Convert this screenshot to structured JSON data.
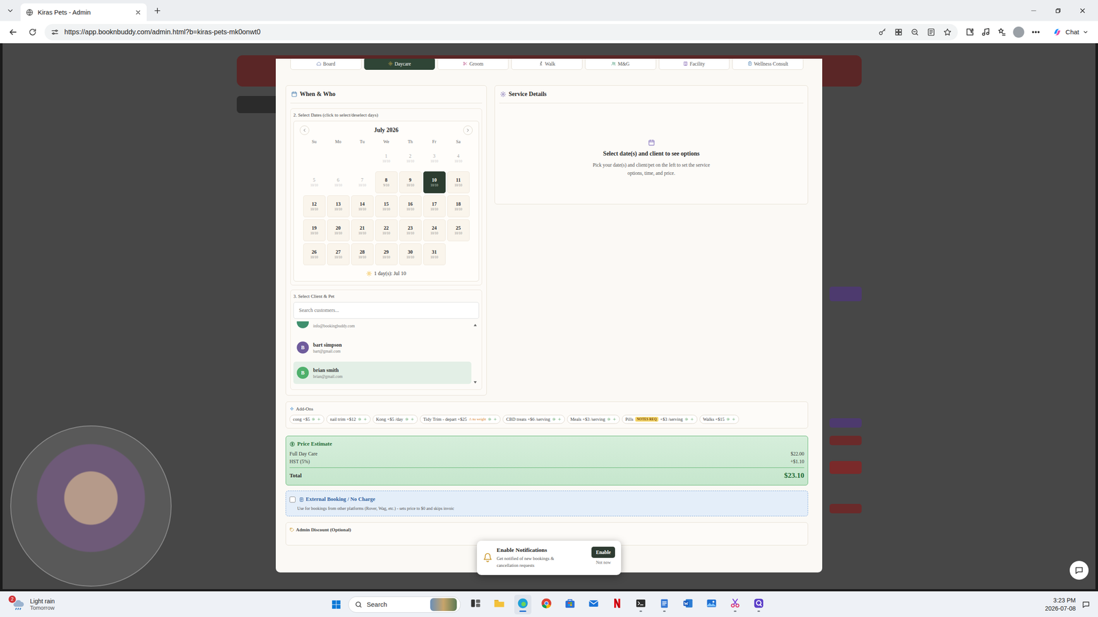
{
  "browser": {
    "tab_title": "Kiras Pets - Admin",
    "url": "https://app.booknbuddy.com/admin.html?b=kiras-pets-mk0onwt0",
    "chat": "Chat"
  },
  "service_tabs": [
    {
      "label": "Board",
      "selected": false
    },
    {
      "label": "Daycare",
      "selected": true
    },
    {
      "label": "Groom",
      "selected": false
    },
    {
      "label": "Walk",
      "selected": false
    },
    {
      "label": "M&G",
      "selected": false
    },
    {
      "label": "Facility",
      "selected": false
    },
    {
      "label": "Wellness Consult",
      "selected": false
    }
  ],
  "when_who": {
    "title": "When & Who",
    "dates_label": "2. Select Dates (click to select/deselect days)",
    "month": "July 2026",
    "weekdays": [
      "Su",
      "Mo",
      "Tu",
      "We",
      "Th",
      "Fr",
      "Sa"
    ],
    "leading_blanks": 3,
    "days": [
      {
        "day": "1",
        "sub": "10/10",
        "disabled": true,
        "selected": false
      },
      {
        "day": "2",
        "sub": "10/10",
        "disabled": true,
        "selected": false
      },
      {
        "day": "3",
        "sub": "10/10",
        "disabled": true,
        "selected": false
      },
      {
        "day": "4",
        "sub": "10/10",
        "disabled": true,
        "selected": false
      },
      {
        "day": "5",
        "sub": "10/10",
        "disabled": true,
        "selected": false
      },
      {
        "day": "6",
        "sub": "10/10",
        "disabled": true,
        "selected": false
      },
      {
        "day": "7",
        "sub": "10/10",
        "disabled": true,
        "selected": false
      },
      {
        "day": "8",
        "sub": "9/10",
        "disabled": false,
        "selected": false
      },
      {
        "day": "9",
        "sub": "10/10",
        "disabled": false,
        "selected": false
      },
      {
        "day": "10",
        "sub": "10/10",
        "disabled": false,
        "selected": true
      },
      {
        "day": "11",
        "sub": "10/10",
        "disabled": false,
        "selected": false
      },
      {
        "day": "12",
        "sub": "10/10",
        "disabled": false,
        "selected": false
      },
      {
        "day": "13",
        "sub": "10/10",
        "disabled": false,
        "selected": false
      },
      {
        "day": "14",
        "sub": "10/10",
        "disabled": false,
        "selected": false
      },
      {
        "day": "15",
        "sub": "10/10",
        "disabled": false,
        "selected": false
      },
      {
        "day": "16",
        "sub": "10/10",
        "disabled": false,
        "selected": false
      },
      {
        "day": "17",
        "sub": "10/10",
        "disabled": false,
        "selected": false
      },
      {
        "day": "18",
        "sub": "10/10",
        "disabled": false,
        "selected": false
      },
      {
        "day": "19",
        "sub": "10/10",
        "disabled": false,
        "selected": false
      },
      {
        "day": "20",
        "sub": "10/10",
        "disabled": false,
        "selected": false
      },
      {
        "day": "21",
        "sub": "10/10",
        "disabled": false,
        "selected": false
      },
      {
        "day": "22",
        "sub": "10/10",
        "disabled": false,
        "selected": false
      },
      {
        "day": "23",
        "sub": "10/10",
        "disabled": false,
        "selected": false
      },
      {
        "day": "24",
        "sub": "10/10",
        "disabled": false,
        "selected": false
      },
      {
        "day": "25",
        "sub": "10/10",
        "disabled": false,
        "selected": false
      },
      {
        "day": "26",
        "sub": "10/10",
        "disabled": false,
        "selected": false
      },
      {
        "day": "27",
        "sub": "10/10",
        "disabled": false,
        "selected": false
      },
      {
        "day": "28",
        "sub": "10/10",
        "disabled": false,
        "selected": false
      },
      {
        "day": "29",
        "sub": "10/10",
        "disabled": false,
        "selected": false
      },
      {
        "day": "30",
        "sub": "10/10",
        "disabled": false,
        "selected": false
      },
      {
        "day": "31",
        "sub": "10/10",
        "disabled": false,
        "selected": false
      }
    ],
    "summary": "1 day(s): Jul 10",
    "client_label": "3. Select Client & Pet",
    "search_placeholder": "Search customers...",
    "customers": [
      {
        "kind": "partial",
        "email": "info@bookingbuddy.com",
        "color": "#3f8f6e",
        "selected": false
      },
      {
        "kind": "full",
        "initial": "B",
        "name": "bart simpson",
        "email": "bart@gmail.com",
        "color": "#6f5c9c",
        "selected": false
      },
      {
        "kind": "full",
        "initial": "B",
        "name": "brian smith",
        "email": "brian@gmail.com",
        "color": "#4fb06c",
        "selected": true
      }
    ]
  },
  "service_details": {
    "title": "Service Details",
    "empty_title": "Select date(s) and client to see options",
    "empty_text": "Pick your date(s) and client/pet on the left to set the service options, time, and price."
  },
  "addons": {
    "title": "Add-Ons",
    "items": [
      {
        "kind": "plain",
        "label": "cong +$5"
      },
      {
        "kind": "plain",
        "label": "nail trim +$12"
      },
      {
        "kind": "plain",
        "label": "Kong +$5 /day"
      },
      {
        "kind": "warn",
        "label": "Tidy Trim - depart +$25",
        "note": "⚠ no weight"
      },
      {
        "kind": "plain",
        "label": "CBD treats +$6 /serving"
      },
      {
        "kind": "plain",
        "label": "Meals +$3 /serving"
      },
      {
        "kind": "badge",
        "label": "Pills",
        "badge": "NOTES REQ",
        "price": "+$3 /serving"
      },
      {
        "kind": "plain",
        "label": "Walks +$15"
      }
    ]
  },
  "price_estimate": {
    "title": "Price Estimate",
    "lines": [
      {
        "label": "Full Day Care",
        "amount": "$22.00"
      },
      {
        "label": "HST (5%)",
        "amount": "+$1.10"
      }
    ],
    "total_label": "Total",
    "total": "$23.10"
  },
  "external_booking": {
    "title": "External Booking / No Charge",
    "checked": false,
    "text": "Use for bookings from other platforms (Rover, Wag, etc.) - sets price to $0 and skips invoic"
  },
  "admin_discount": {
    "title": "Admin Discount (Optional)"
  },
  "notification": {
    "title": "Enable Notifications",
    "text": "Get notified of new bookings & cancellation requests",
    "enable": "Enable",
    "dismiss": "Not now"
  },
  "taskbar": {
    "weather_badge": "2",
    "weather": "Light rain",
    "weather_sub": "Tomorrow",
    "search": "Search",
    "time": "3:23 PM",
    "date": "2026-07-08",
    "apps": [
      {
        "kind": "taskview",
        "running": false,
        "active": false
      },
      {
        "kind": "explorer",
        "running": false,
        "active": false
      },
      {
        "kind": "edge",
        "running": true,
        "active": true
      },
      {
        "kind": "chrome",
        "running": false,
        "active": false
      },
      {
        "kind": "store",
        "running": false,
        "active": false
      },
      {
        "kind": "mail",
        "running": false,
        "active": false
      },
      {
        "kind": "netflix",
        "running": false,
        "active": false
      },
      {
        "kind": "terminal",
        "running": true,
        "active": false
      },
      {
        "kind": "notepad",
        "running": true,
        "active": false
      },
      {
        "kind": "word",
        "running": false,
        "active": false
      },
      {
        "kind": "photos",
        "running": false,
        "active": false
      },
      {
        "kind": "snip",
        "running": true,
        "active": false
      },
      {
        "kind": "app",
        "running": true,
        "active": false
      }
    ]
  }
}
